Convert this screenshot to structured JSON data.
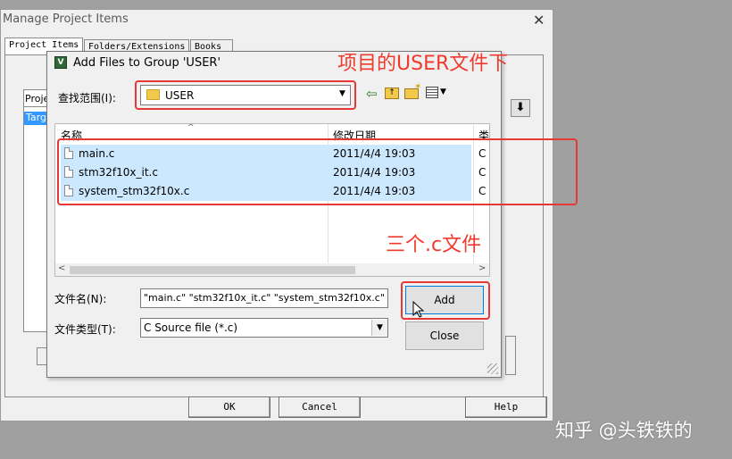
{
  "background_window": {
    "title": "Manage Project Items",
    "close_glyph": "✕",
    "tabs": [
      "Project Items",
      "Folders/Extensions",
      "Books"
    ],
    "list_header_fragment": "Proje",
    "list_item_fragment": "Targe",
    "buttons": {
      "ok": "OK",
      "cancel": "Cancel",
      "help": "Help"
    }
  },
  "dialog": {
    "title": "Add Files to Group 'USER'",
    "lookin_label": "查找范围(I):",
    "lookin_value": "USER",
    "columns": {
      "name": "名称",
      "modified": "修改日期",
      "type": "类"
    },
    "files": [
      {
        "name": "main.c",
        "modified": "2011/4/4 19:03",
        "type": "C"
      },
      {
        "name": "stm32f10x_it.c",
        "modified": "2011/4/4 19:03",
        "type": "C"
      },
      {
        "name": "system_stm32f10x.c",
        "modified": "2011/4/4 19:03",
        "type": "C"
      }
    ],
    "filename_label": "文件名(N):",
    "filename_value": "\"main.c\" \"stm32f10x_it.c\" \"system_stm32f10x.c\"",
    "filetype_label": "文件类型(T):",
    "filetype_value": "C Source file (*.c)",
    "add_label": "Add",
    "close_label": "Close"
  },
  "annotations": {
    "user_folder": "项目的USER文件下",
    "three_files": "三个.c文件",
    "accent_color": "#e53935"
  },
  "watermark": "知乎 @头铁铁的",
  "icons": [
    "app-icon",
    "folder-icon",
    "back-arrow-icon",
    "up-folder-icon",
    "new-folder-icon",
    "view-menu-icon",
    "file-icon",
    "mouse-cursor-icon"
  ]
}
